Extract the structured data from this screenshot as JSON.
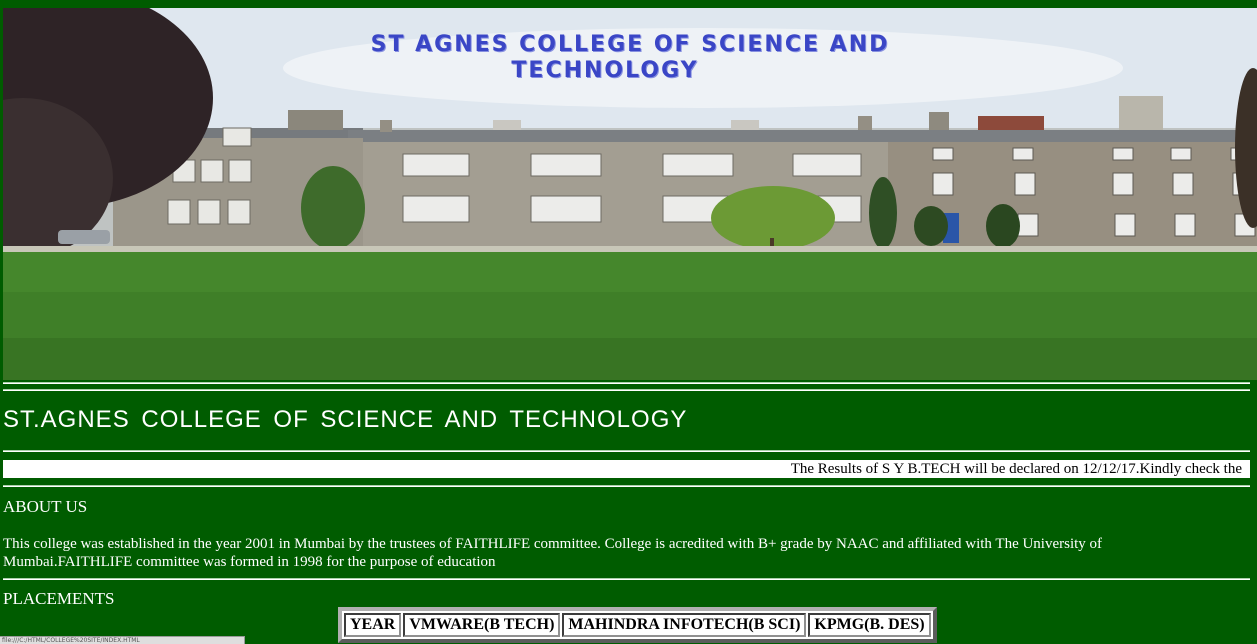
{
  "banner": {
    "title_line1": "ST AGNES COLLEGE OF SCIENCE AND",
    "title_line2": "TECHNOLOGY"
  },
  "heading": "ST.AGNES COLLEGE OF SCIENCE AND TECHNOLOGY",
  "marquee": "The Results of S Y B.TECH will be declared on 12/12/17.Kindly check the",
  "about": {
    "title": "ABOUT US",
    "text": "This college was established in the year 2001 in Mumbai by the trustees of FAITHLIFE committee. College is acredited with B+ grade by NAAC and affiliated with The University of Mumbai.FAITHLIFE committee was formed in 1998 for the purpose of education"
  },
  "placements": {
    "title": "PLACEMENTS",
    "headers": [
      "YEAR",
      "VMWARE(B TECH)",
      "MAHINDRA INFOTECH(B SCI)",
      "KPMG(B. DES)"
    ]
  },
  "status_bar": "file:///C:/HTML/COLLEGE%20SITE/INDEX.HTML",
  "colors": {
    "page_background": "#005c00",
    "banner_title": "#3a46c6",
    "text": "#ffffff"
  }
}
